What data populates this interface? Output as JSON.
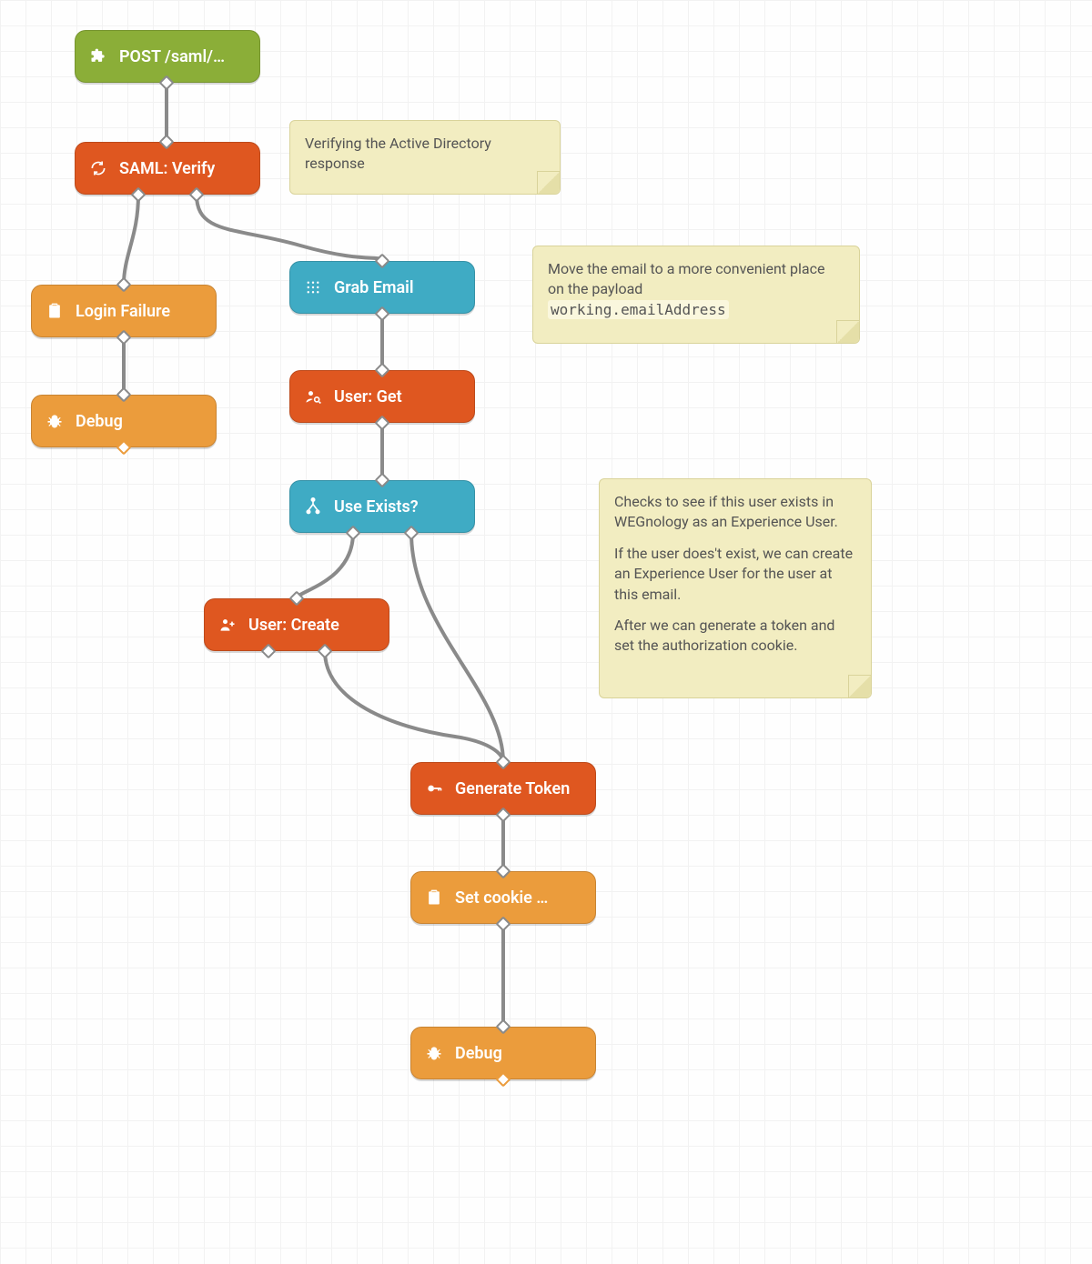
{
  "nodes": {
    "post": {
      "label": "POST /saml/…"
    },
    "verify": {
      "label": "SAML: Verify"
    },
    "loginFail": {
      "label": "Login Failure"
    },
    "debug1": {
      "label": "Debug"
    },
    "grabEmail": {
      "label": "Grab Email"
    },
    "userGet": {
      "label": "User: Get"
    },
    "useExists": {
      "label": "Use Exists?"
    },
    "userCreate": {
      "label": "User: Create"
    },
    "genToken": {
      "label": "Generate Token"
    },
    "setCookie": {
      "label": "Set cookie …"
    },
    "debug2": {
      "label": "Debug"
    }
  },
  "notes": {
    "n1": {
      "text": "Verifying the Active Directory response"
    },
    "n2": {
      "line1": "Move the email to a more convenient place on the payload",
      "code": "working.emailAddress"
    },
    "n3": {
      "p1": "Checks to see if this user exists in WEGnology as an Experience User.",
      "p2": "If the user does't exist, we can create an Experience User for the user at this email.",
      "p3": "After we can generate a token and set the authorization cookie."
    }
  }
}
